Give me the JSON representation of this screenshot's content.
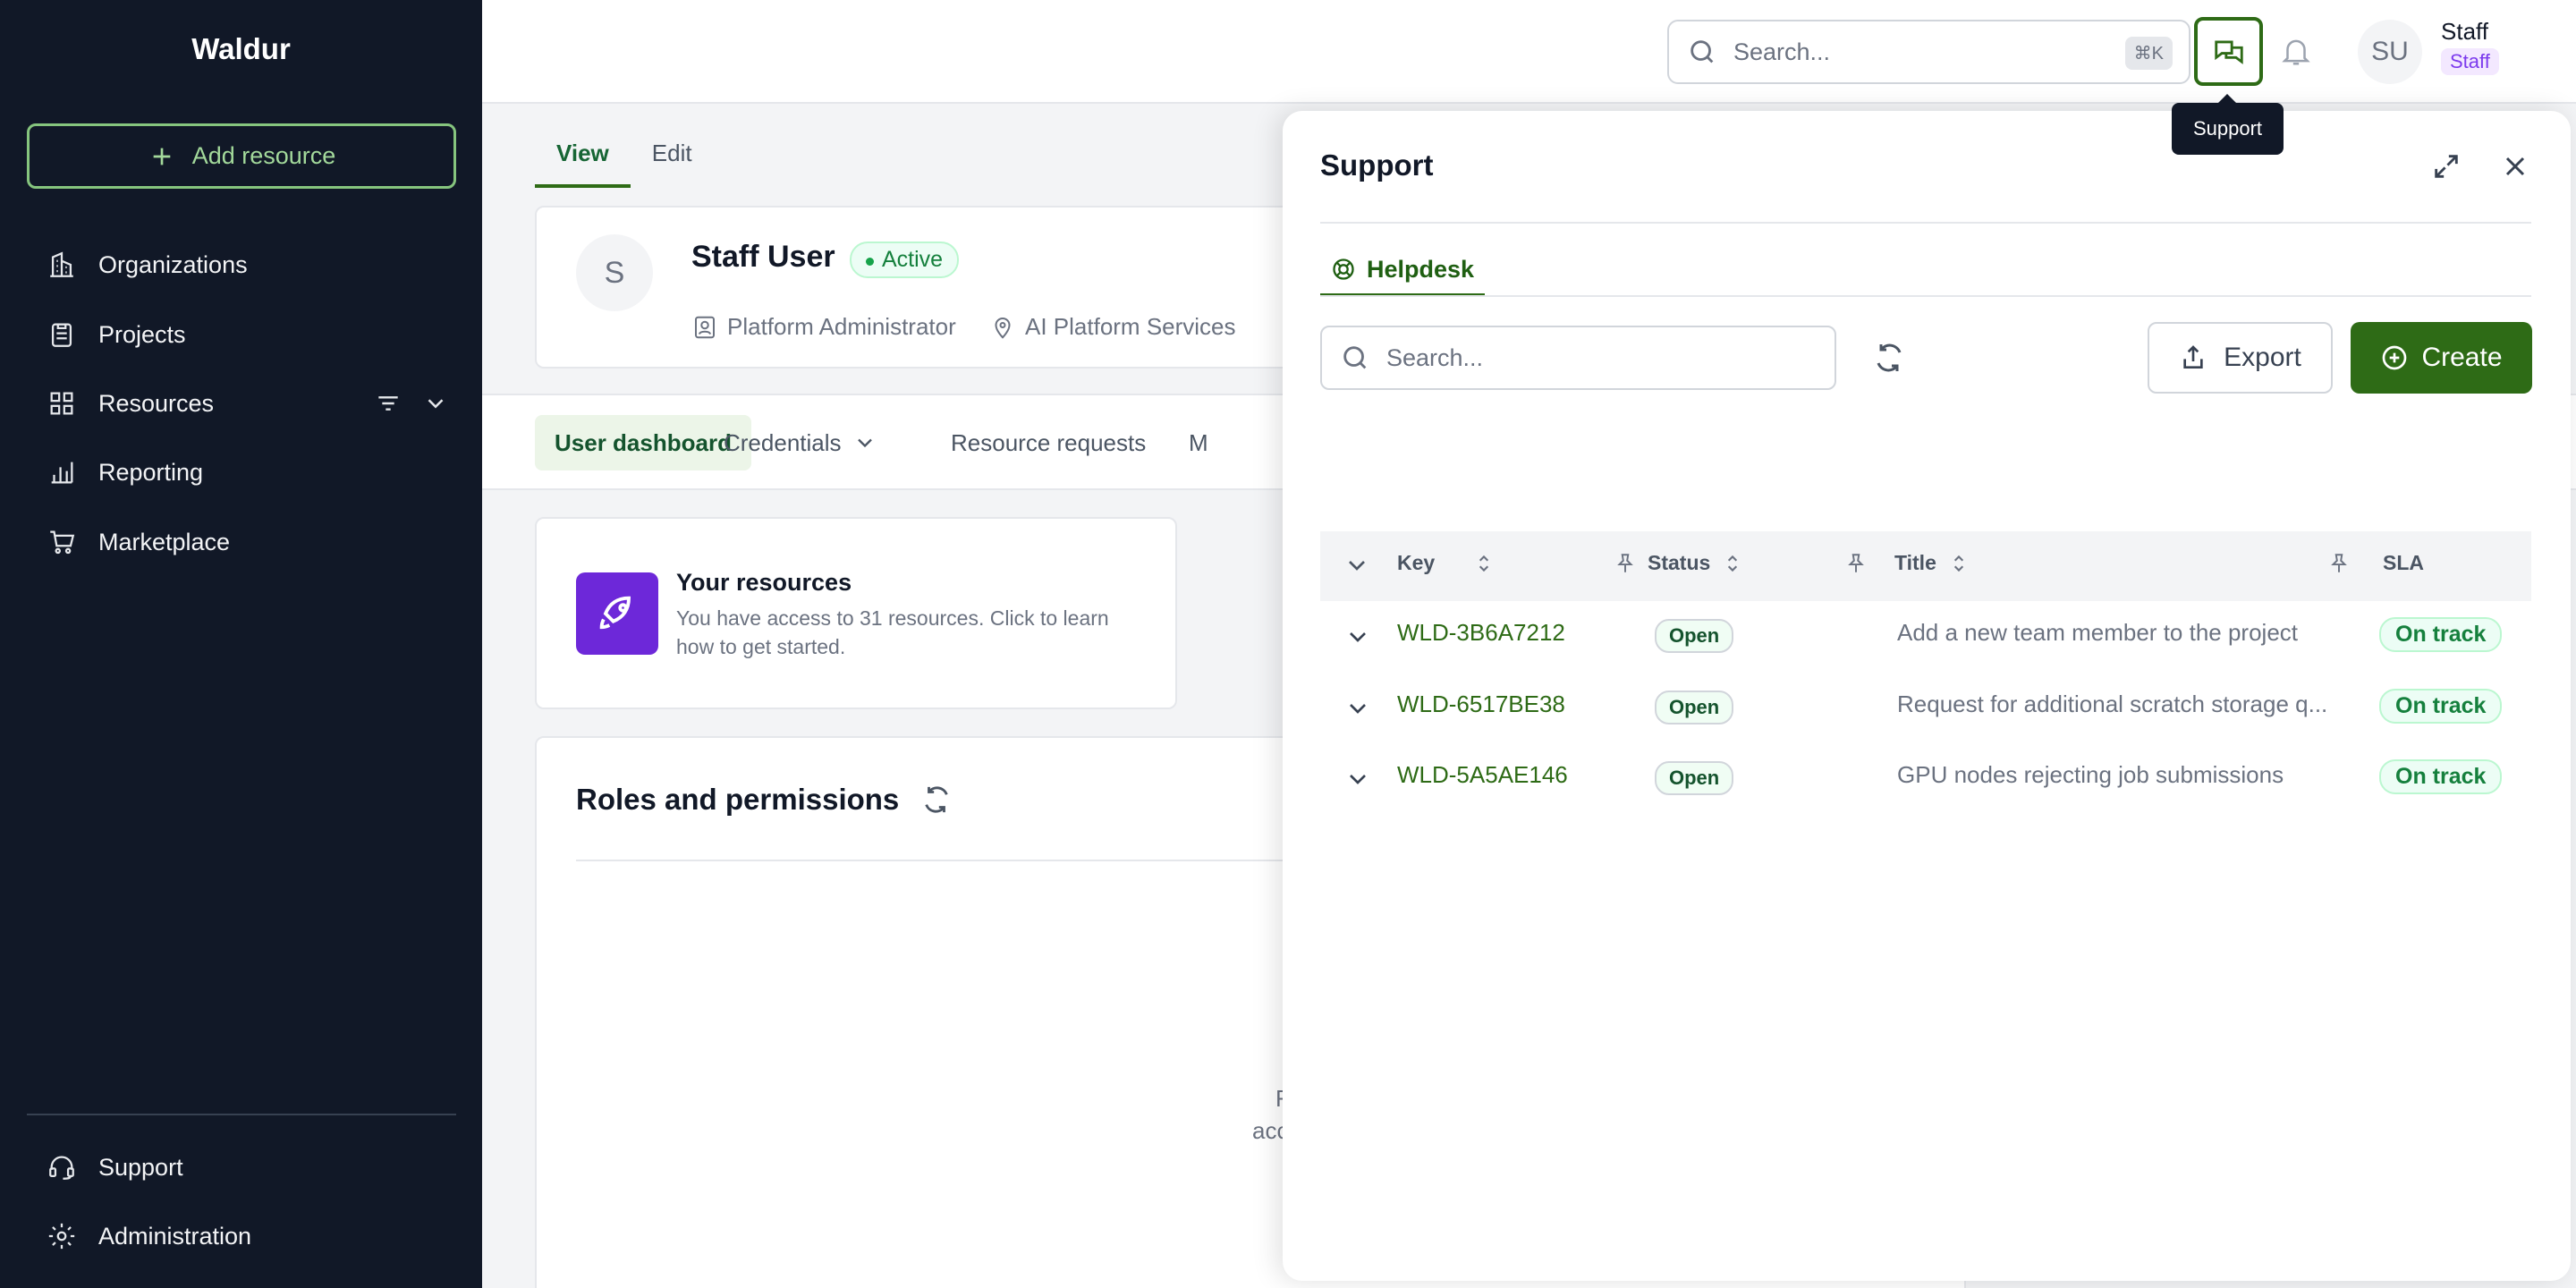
{
  "app": {
    "brand": "Waldur"
  },
  "sidebar": {
    "add_resource_label": "Add resource",
    "items": [
      {
        "label": "Organizations",
        "icon": "building-icon"
      },
      {
        "label": "Projects",
        "icon": "clipboard-icon"
      },
      {
        "label": "Resources",
        "icon": "grid-icon"
      },
      {
        "label": "Reporting",
        "icon": "bar-chart-icon"
      },
      {
        "label": "Marketplace",
        "icon": "cart-icon"
      }
    ],
    "bottom": [
      {
        "label": "Support",
        "icon": "headset-icon"
      },
      {
        "label": "Administration",
        "icon": "gear-icon"
      }
    ]
  },
  "topbar": {
    "search_placeholder": "Search...",
    "shortcut": "⌘K",
    "support_tooltip": "Support",
    "user_initials": "SU",
    "user_name": "Staff",
    "user_role": "Staff"
  },
  "page": {
    "tabs": [
      "View",
      "Edit"
    ],
    "profile": {
      "initial": "S",
      "name": "Staff User",
      "status": "Active",
      "meta": [
        "Platform Administrator",
        "AI Platform Services"
      ]
    },
    "subtabs": [
      "User dashboard",
      "Credentials",
      "Resource requests",
      "M"
    ],
    "resources_card": {
      "title": "Your resources",
      "description": "You have access to 31 resources. Click to learn how to get started."
    },
    "roles": {
      "title": "Roles and permissions",
      "ghost_line1": "F",
      "ghost_line2": "acc"
    }
  },
  "support_panel": {
    "title": "Support",
    "tab": "Helpdesk",
    "search_placeholder": "Search...",
    "export_label": "Export",
    "create_label": "Create",
    "columns": [
      "Key",
      "Status",
      "Title",
      "SLA"
    ],
    "rows": [
      {
        "key": "WLD-3B6A7212",
        "status": "Open",
        "title": "Add a new team member to the project",
        "sla": "On track"
      },
      {
        "key": "WLD-6517BE38",
        "status": "Open",
        "title": "Request for additional scratch storage q...",
        "sla": "On track"
      },
      {
        "key": "WLD-5A5AE146",
        "status": "Open",
        "title": "GPU nodes rejecting job submissions",
        "sla": "On track"
      }
    ]
  },
  "colors": {
    "brand_green": "#2e6b16",
    "sidebar_bg": "#111827",
    "accent_purple": "#6d28d9"
  }
}
